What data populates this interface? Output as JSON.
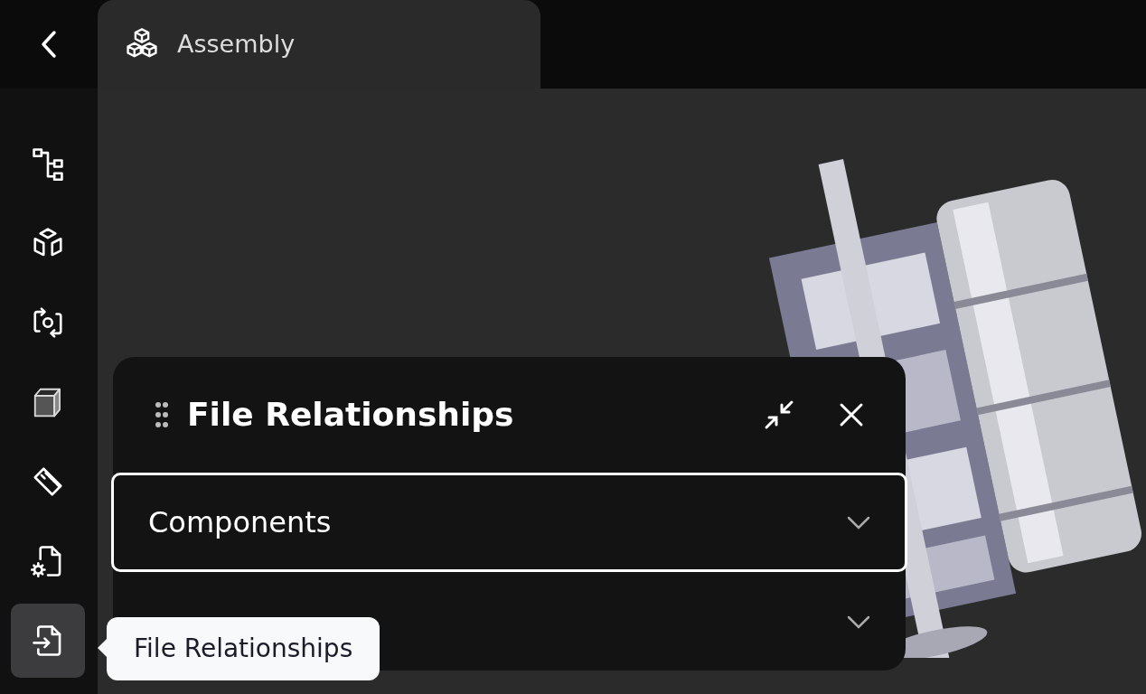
{
  "header": {
    "tab": {
      "title": "Assembly",
      "selected": true
    }
  },
  "sidebar": {
    "items": [
      {
        "kind": "tree",
        "selected": false
      },
      {
        "kind": "exploded",
        "selected": false
      },
      {
        "kind": "rotate",
        "selected": false
      },
      {
        "kind": "cube",
        "selected": false
      },
      {
        "kind": "ruler",
        "selected": false
      },
      {
        "kind": "file-settings",
        "selected": false
      },
      {
        "kind": "file-relationships",
        "selected": true
      }
    ]
  },
  "panel": {
    "title": "File Relationships",
    "sections": [
      {
        "label": "Components",
        "expanded": false,
        "focused": true
      },
      {
        "expanded": false,
        "focused": false
      }
    ]
  },
  "tooltip": {
    "text": "File Relationships"
  }
}
